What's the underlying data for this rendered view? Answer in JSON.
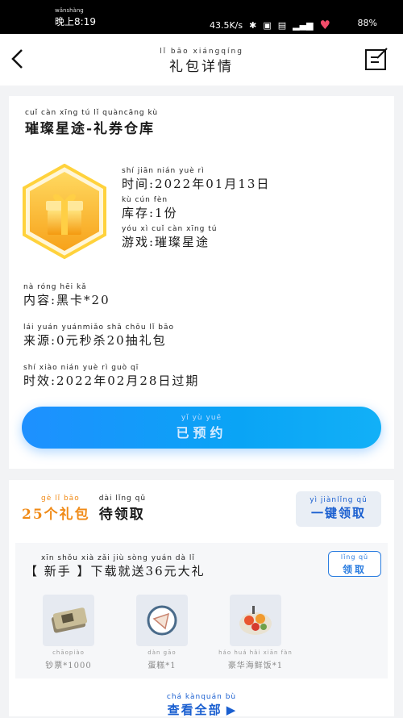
{
  "status": {
    "time_pinyin": "wǎnshàng",
    "time": "晚上8:19",
    "speed": "43.5K/s",
    "battery": "88%"
  },
  "nav": {
    "title_pinyin": "lǐ   bāo xiángqíng",
    "title": "礼包详情"
  },
  "pack": {
    "name_pinyin": "cuǐ càn xīng  tú    lǐ  quàncāng  kù",
    "name": "璀璨星途-礼券仓库",
    "time_pinyin": "shí jiān                 nián      yuè       rì",
    "time": "时间:2022年01月13日",
    "stock_pinyin": "kù  cún          fèn",
    "stock": "库存:1份",
    "game_pinyin": "yóu  xì       cuǐ càn xīng  tú",
    "game": "游戏:璀璨星途",
    "content_pinyin": "nà  róng        hēi  kǎ",
    "content": "内容:黑卡*20",
    "source_pinyin": "lái yuán      yuánmiǎo shā     chōu  lǐ   bāo",
    "source": "来源:0元秒杀20抽礼包",
    "validity_pinyin": "shí xiào                  nián      yuè       rì  guò  qī",
    "validity": "时效:2022年02月28日过期",
    "reserve_pinyin": "yǐ  yù  yuē",
    "reserve": "已预约"
  },
  "packs_section": {
    "count_pinyin": "gè  lǐ  bāo",
    "count": "25个礼包",
    "pending_pinyin": "dài lǐng qǔ",
    "pending": "待领取",
    "onekey_pinyin": "yì  jiànlǐng qǔ",
    "onekey": "一键领取",
    "newbie": {
      "title_pinyin": "xīn shǒu          xià  zǎi  jiù sòng      yuán  dà   lǐ",
      "title": "【 新手 】下载就送36元大礼",
      "claim_pinyin": "lǐng qǔ",
      "claim": "领取",
      "items": [
        {
          "pinyin": "chāopiào",
          "name": "钞票*1000",
          "icon": "cash-icon"
        },
        {
          "pinyin": "dàn gāo",
          "name": "蛋糕*1",
          "icon": "cake-icon"
        },
        {
          "pinyin": "háo huá  hǎi xiān fàn",
          "name": "豪华海鲜饭*1",
          "icon": "seafood-rice-icon"
        }
      ]
    },
    "seeall_pinyin": "chá kànquán  bù",
    "seeall": "查看全部"
  }
}
